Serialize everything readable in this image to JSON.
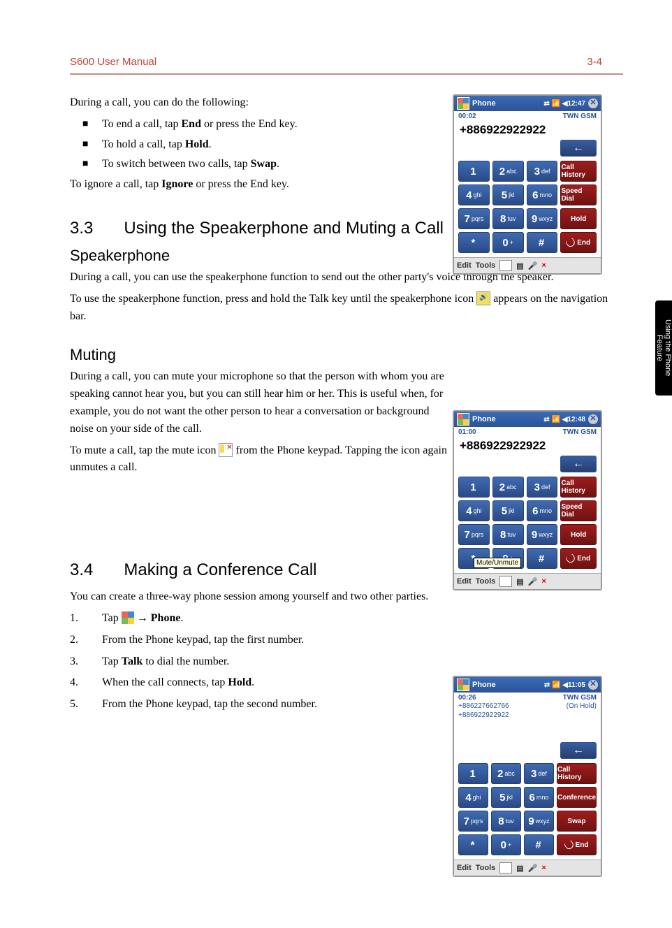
{
  "header": {
    "title": "S600 User Manual",
    "page": "3-4"
  },
  "sideTab": "Using the Phone Feature",
  "section1": {
    "intro": "During a call, you can do the following:",
    "bullets": [
      [
        "To end a call, tap ",
        "End",
        " or press the End key."
      ],
      [
        "To hold a call, tap ",
        "Hold",
        "."
      ],
      [
        "To switch between two calls, tap ",
        "Swap",
        "."
      ]
    ],
    "after": [
      "To ignore a call, tap ",
      "Ignore",
      " or press the End key."
    ]
  },
  "section33": {
    "num": "3.3",
    "title": "Using the Speakerphone and Muting a Call",
    "speakerphone": {
      "heading": "Speakerphone",
      "p1": "During a call, you can use the speakerphone function to send out the other party's voice through the speaker.",
      "p2_a": "To use the speakerphone function, press and hold the Talk key until the speakerphone icon ",
      "p2_b": " appears on the navigation bar."
    },
    "muting": {
      "heading": "Muting",
      "p1": "During a call, you can mute your microphone so that the person with whom you are speaking cannot hear you, but you can still hear him or her. This is useful when, for example, you do not want the other person to hear a conversation or background noise on your side of the call.",
      "p2_a": "To mute a call, tap the mute icon ",
      "p2_b": " from the Phone keypad. Tapping the icon again unmutes a call."
    }
  },
  "section34": {
    "num": "3.4",
    "title": "Making a Conference Call",
    "intro": "You can create a three-way phone session among yourself and two other parties.",
    "steps": [
      [
        "Tap ",
        "START_ICON",
        " → ",
        "Phone",
        "."
      ],
      [
        "From the Phone keypad, tap the first number."
      ],
      [
        "Tap ",
        "Talk",
        " to dial the number."
      ],
      [
        "When the call connects, tap ",
        "Hold",
        "."
      ],
      [
        "From the Phone keypad, tap the second number."
      ]
    ]
  },
  "keypad": {
    "keys": [
      [
        "1",
        ""
      ],
      [
        "2",
        "abc"
      ],
      [
        "3",
        "def"
      ],
      [
        "4",
        "ghi"
      ],
      [
        "5",
        "jkl"
      ],
      [
        "6",
        "mno"
      ],
      [
        "7",
        "pqrs"
      ],
      [
        "8",
        "tuv"
      ],
      [
        "9",
        "wxyz"
      ],
      [
        "*",
        ""
      ],
      [
        "0",
        "+"
      ],
      [
        "#",
        ""
      ]
    ],
    "back": "←"
  },
  "phone1": {
    "title": "Phone",
    "time": "12:47",
    "duration": "00:02",
    "carrier": "TWN GSM",
    "number": "+886922922922",
    "actions": [
      "Call History",
      "Speed Dial",
      "Hold",
      "End"
    ],
    "bottom": {
      "edit": "Edit",
      "tools": "Tools"
    },
    "tooltip": ""
  },
  "phone2": {
    "title": "Phone",
    "time": "12:48",
    "duration": "01:00",
    "carrier": "TWN GSM",
    "number": "+886922922922",
    "actions": [
      "Call History",
      "Speed Dial",
      "Hold",
      "End"
    ],
    "bottom": {
      "edit": "Edit",
      "tools": "Tools"
    },
    "tooltip": "Mute/Unmute"
  },
  "phone3": {
    "title": "Phone",
    "time": "11:05",
    "duration": "00:26",
    "carrier": "TWN GSM",
    "extraNumbers": [
      "+886227662766",
      "+886922922922"
    ],
    "onHold": "(On Hold)",
    "number": "",
    "actions": [
      "Call History",
      "Conference",
      "Swap",
      "End"
    ],
    "bottom": {
      "edit": "Edit",
      "tools": "Tools"
    },
    "tooltip": ""
  }
}
